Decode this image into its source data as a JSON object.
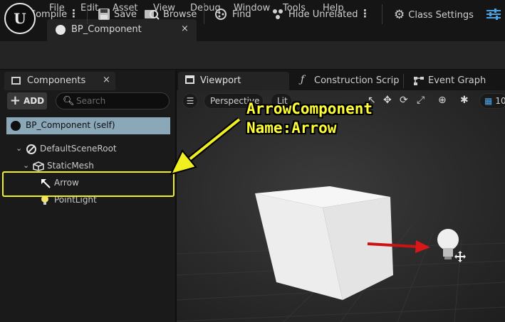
{
  "menu": {
    "logo": "U",
    "items": [
      "File",
      "Edit",
      "Asset",
      "View",
      "Debug",
      "Window",
      "Tools",
      "Help"
    ]
  },
  "document_tab": {
    "label": "BP_Component",
    "close": "×"
  },
  "toolbar": {
    "compile": "Compile",
    "save": "Save",
    "browse": "Browse",
    "find": "Find",
    "hide_unrelated": "Hide Unrelated",
    "class_settings": "Class Settings"
  },
  "components_panel": {
    "tab_label": "Components",
    "close": "×",
    "add_label": "ADD",
    "search_placeholder": "Search",
    "self_item": "BP_Component (self)",
    "tree": [
      {
        "label": "DefaultSceneRoot",
        "icon": "scene-root-icon"
      },
      {
        "label": "StaticMesh",
        "icon": "static-mesh-icon"
      },
      {
        "label": "Arrow",
        "icon": "arrow-icon"
      },
      {
        "label": "PointLight",
        "icon": "light-bulb-icon"
      }
    ]
  },
  "editor_tabs": [
    {
      "label": "Viewport",
      "icon": "viewport-icon"
    },
    {
      "label": "Construction Scrip",
      "icon": "function-icon"
    },
    {
      "label": "Event Graph",
      "icon": "graph-icon"
    }
  ],
  "viewport": {
    "perspective": "Perspective",
    "lit": "Lit",
    "grid_value": "10"
  },
  "annotation": {
    "line1": "ArrowComponent",
    "line2": "Name:Arrow"
  },
  "colors": {
    "annotation": "#ffff33",
    "selection": "#8aa8b8",
    "arrow_component": "#d81818"
  }
}
